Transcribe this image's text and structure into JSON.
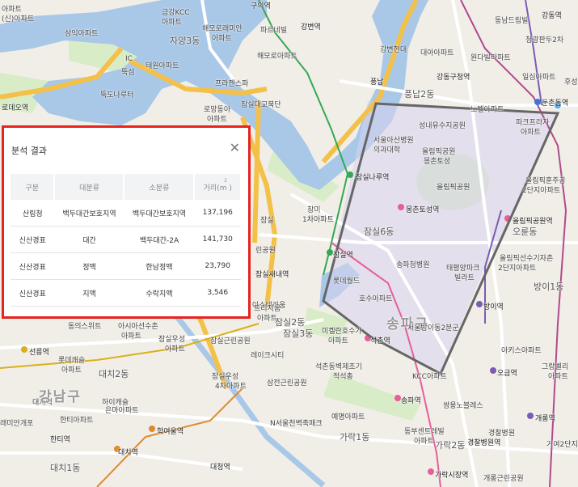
{
  "panel": {
    "title": "분석 결과",
    "close_icon": "close-icon",
    "columns": [
      "구분",
      "대분류",
      "소분류",
      "거리(m )"
    ],
    "unit_superscript": "2",
    "rows": [
      [
        "산림청",
        "백두대간보호지역",
        "백두대간보호지역",
        "137,196"
      ],
      [
        "신산경표",
        "대간",
        "백두대간-2A",
        "141,730"
      ],
      [
        "신산경표",
        "정맥",
        "한남정맥",
        "23,790"
      ],
      [
        "신산경표",
        "지맥",
        "수락지맥",
        "3,546"
      ]
    ]
  },
  "map": {
    "labels": {
      "l0": "(신)아파트",
      "l1": "금강KCC",
      "l2": "아파트",
      "l3": "구의역",
      "l4": "동남드림빌",
      "l5": "강동역",
      "l6": "삼익아파트",
      "l7": "해모로래미안",
      "l8": "아파트",
      "l9": "파르네빌",
      "l10": "강변역",
      "l11": "청광판두2차",
      "l12": "자양3동",
      "l13": "해모로아파트",
      "l14": "강변현대",
      "l15": "대아아파트",
      "l16": "원다빌라파트",
      "l17": "뚝섬",
      "l18": "IC",
      "l19": "태원아파트",
      "l20": "프라젠스파",
      "l21": "잠실대교북단",
      "l22": "풍납",
      "l23": "풍납2동",
      "l24": "강동구청역",
      "l25": "일심아파트",
      "l26": "후성",
      "l27": "아파트",
      "l28": "뚝도나루터",
      "l29": "로망동아",
      "l30": "아파트",
      "l31": "노벨아파트",
      "l32": "둔촌동역",
      "l33": "로데오역",
      "l34": "성내유수지공원",
      "l35": "파크프라자",
      "l36": "아파트",
      "l37": "서울아산병원",
      "l38": "의과대학",
      "l39": "올림픽공원",
      "l40": "몽촌토성",
      "l41": "잠실나루역",
      "l42": "올림픽공원",
      "l43": "올림픽훈주공",
      "l44": "2단지아파트",
      "l45": "잠실",
      "l46": "창미",
      "l47": "1차아파트",
      "l48": "몽촌토성역",
      "l49": "올림픽공원역",
      "l50": "오륜동",
      "l51": "잠실6동",
      "l52": "잠실역",
      "l53": "송파청병원",
      "l54": "올림픽선수기자촌",
      "l55": "2단지아파트",
      "l56": "태평양파크",
      "l57": "빌라트",
      "l58": "롯데월드",
      "l59": "호수아파트",
      "l60": "방이역",
      "l61": "잠실2동",
      "l62": "미켈란호수가",
      "l63": "아파트",
      "l64": "송파구",
      "l65": "서울방이동2분군",
      "l66": "석촌역",
      "l67": "아키스아파트",
      "l68": "잠실우성",
      "l69": "아파트",
      "l70": "잠실근린공원",
      "l71": "레이크시티",
      "l72": "석촌동벽제조기",
      "l73": "적석총",
      "l74": "KCC아파트",
      "l75": "오금역",
      "l76": "그랑벨리",
      "l77": "아파트",
      "l78": "잠실우성",
      "l79": "4차아파트",
      "l80": "삼전근린공원",
      "l81": "송파역",
      "l82": "쌍용노블레스",
      "l83": "선릉역",
      "l84": "롯데캐슬",
      "l85": "아파트",
      "l86": "대치2동",
      "l87": "대치역",
      "l88": "하이캐슬",
      "l89": "한티아파트",
      "l90": "은마아파트",
      "l91": "학여울역",
      "l92": "N서울천벽축패크",
      "l93": "예명아파트",
      "l94": "동부센트레빌",
      "l95": "아파트",
      "l96": "경찰병원역",
      "l97": "개롱역",
      "l98": "거여2단지",
      "l99": "래미안개포",
      "l100": "한티역",
      "l101": "대치역",
      "l102": "대청역",
      "l103": "가락시장역",
      "l104": "개롱근린공원",
      "l105": "가락1동",
      "l106": "가락2동",
      "l107": "강남구",
      "l108": "대치1동",
      "l109": "아시아선수촌",
      "l110": "아파트",
      "l111": "방이1동",
      "l112": "동의스위트",
      "l113": "아스테리움",
      "l114": "잠실새내역",
      "l115": "트리지움",
      "l116": "아파트",
      "l117": "린공원",
      "l118": "잠실3동",
      "l119": "경찰병원"
    }
  }
}
